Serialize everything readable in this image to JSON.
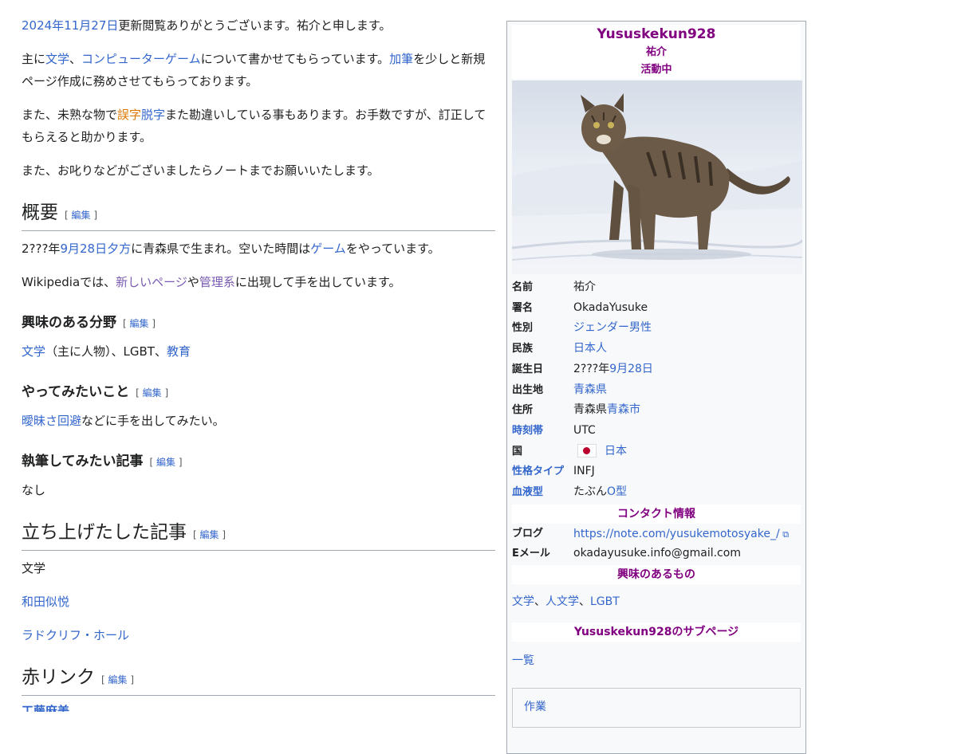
{
  "intro": {
    "p1": {
      "date_year": "2024年",
      "date_md": "11月27日",
      "rest": "更新閲覧ありがとうございます。祐介と申します。"
    },
    "p2": {
      "pre": "主に",
      "link1": "文学",
      "sep": "、",
      "link2": "コンピューターゲーム",
      "mid": "について書かせてもらっています。",
      "link3": "加筆",
      "post": "を少しと新規ページ作成に務めさせてもらっております。"
    },
    "p3": {
      "pre": "また、未熟な物で",
      "link1": "誤字",
      "link2": "脱字",
      "post": "また勘違いしている事もあります。お手数ですが、訂正してもらえると助かります。"
    },
    "p4": "また、お叱りなどがございましたらノートまでお願いいたします。"
  },
  "edit_label": "編集",
  "overview": {
    "heading": "概要",
    "p1": {
      "pre": "2???年",
      "link1": "9月28日",
      "link2": "夕方",
      "mid": "に青森県で生まれ。空いた時間は",
      "link3": "ゲーム",
      "post": "をやっています。"
    },
    "p2": {
      "pre": "Wikipediaでは、",
      "link1": "新しいページ",
      "mid": "や",
      "link2": "管理系",
      "post": "に出現して手を出しています。"
    }
  },
  "interests": {
    "heading": "興味のある分野",
    "link1": "文学",
    "mid": "（主に人物）、LGBT、",
    "link2": "教育"
  },
  "todo": {
    "heading": "やってみたいこと",
    "link": "曖昧さ回避",
    "post": "などに手を出してみたい。"
  },
  "want_write": {
    "heading": "執筆してみたい記事",
    "text": "なし"
  },
  "created": {
    "heading": "立ち上げたした記事",
    "items": [
      "文学",
      "和田似悦",
      "ラドクリフ・ホール"
    ]
  },
  "redlinks": {
    "heading": "赤リンク",
    "cut_item": "工藤麻美"
  },
  "infobox": {
    "title": "Yususkekun928",
    "subtitle": "祐介",
    "status": "活動中",
    "photo_icon": "tabby-cat-in-snow",
    "rows": [
      {
        "k": "名前",
        "v": "祐介"
      },
      {
        "k": "署名",
        "v": "OkadaYusuke"
      },
      {
        "k": "性別",
        "v": "ジェンダー男性"
      },
      {
        "k": "民族",
        "v": "日本人"
      },
      {
        "k": "誕生日",
        "v_pre": "2???年",
        "v_link": "9月28日"
      },
      {
        "k": "出生地",
        "v": "青森県"
      },
      {
        "k": "住所",
        "v_pre": "青森県",
        "v_link": "青森市"
      },
      {
        "k": "時刻帯",
        "v": "UTC"
      },
      {
        "k": "国",
        "v": "日本"
      },
      {
        "k": "性格タイプ",
        "v": "INFJ"
      },
      {
        "k": "血液型",
        "v_pre": "たぶん",
        "v_link": "O型"
      }
    ],
    "contact_head": "コンタクト情報",
    "blog_k": "ブログ",
    "blog_v": "https://note.com/yusukemotosyake_/",
    "email_k": "Eメール",
    "email_v": "okadayusuke.info@gmail.com",
    "likes_head": "興味のあるもの",
    "likes": {
      "a": "文学",
      "b": "人文学",
      "c": "LGBT"
    },
    "subpages_head": "Yususkekun928のサブページ",
    "subpages_link": "一覧",
    "work_label": "作業"
  },
  "colors": {
    "link": "#3366cc",
    "visited": "#795cb2",
    "orange": "#dd7700",
    "infobox_title": "#800080"
  }
}
